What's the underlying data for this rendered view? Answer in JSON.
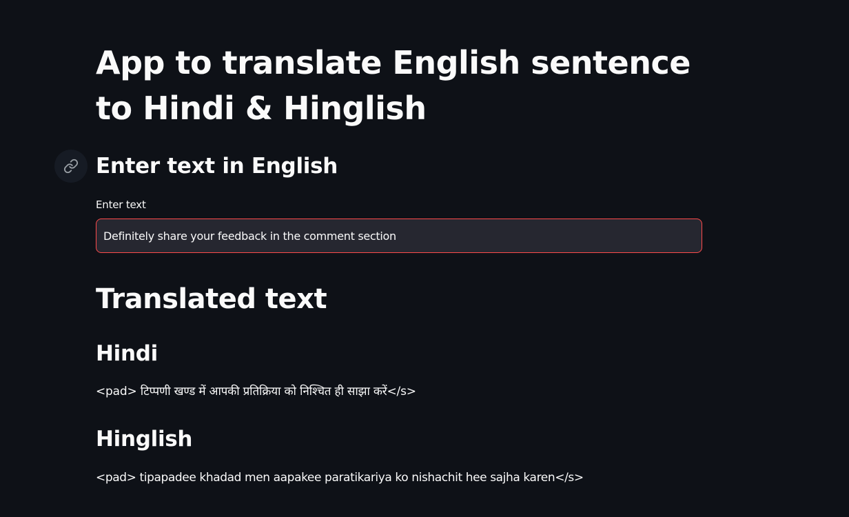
{
  "page": {
    "title": "App to translate English sentence to Hindi & Hinglish"
  },
  "input_section": {
    "heading": "Enter text in English",
    "anchor_icon": "link-icon",
    "field_label": "Enter text",
    "field_value": "Definitely share your feedback in the comment section"
  },
  "output_section": {
    "heading": "Translated text",
    "hindi": {
      "heading": "Hindi",
      "text": "<pad> टिप्पणी खण्ड में आपकी प्रतिक्रिया को निश्चित ही साझा करें</s>"
    },
    "hinglish": {
      "heading": "Hinglish",
      "text": "<pad> tipapadee khadad men aapakee paratikariya ko nishachit hee sajha karen</s>"
    }
  },
  "colors": {
    "background": "#0e1117",
    "text": "#fafafa",
    "input_background": "#262730",
    "focus_border": "#ff4b4b"
  }
}
